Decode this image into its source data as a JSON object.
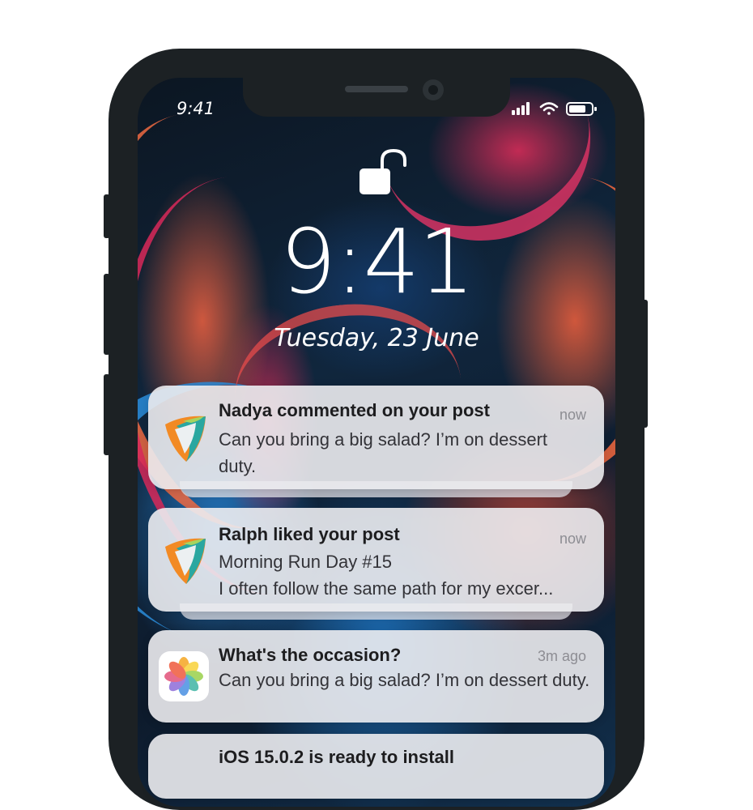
{
  "status_bar": {
    "time": "9:41"
  },
  "lock_screen": {
    "clock": "9:41",
    "date": "Tuesday,  23 June"
  },
  "notifications": [
    {
      "app_icon": "shield-logo-icon",
      "title": "Nadya commented on your post",
      "time": "now",
      "body": "Can you bring a big salad? I’m on dessert duty."
    },
    {
      "app_icon": "shield-logo-icon",
      "title": "Ralph liked your post",
      "time": "now",
      "body_line1": "Morning Run Day #15",
      "body_line2": "I often follow the same path for my excer..."
    },
    {
      "app_icon": "photos-icon",
      "title": "What's the occasion?",
      "time": "3m ago",
      "body": "Can you bring a big salad? I’m on dessert duty."
    },
    {
      "app_icon": "",
      "title": "iOS 15.0.2 is ready to install"
    }
  ],
  "colors": {
    "frame": "#1c2124",
    "card": "#ececf0",
    "accent_orange": "#ef6a42",
    "accent_teal": "#2aa7a0"
  }
}
